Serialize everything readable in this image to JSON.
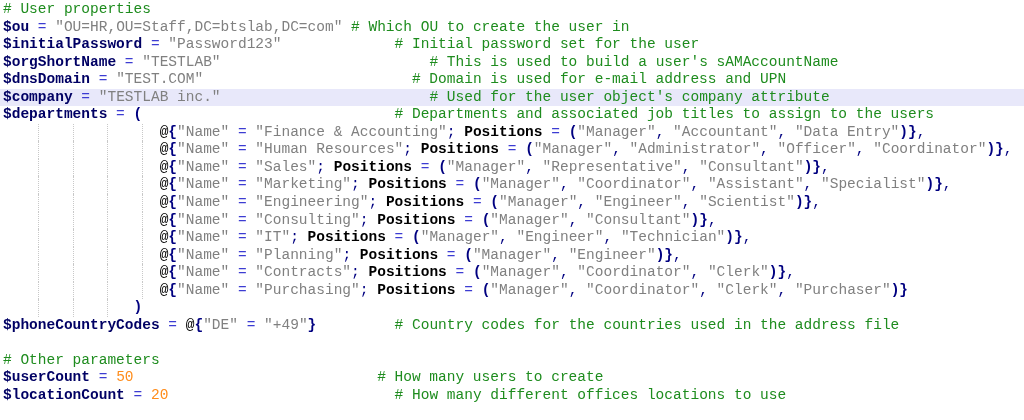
{
  "editor": {
    "lines": [
      {
        "kind": "code",
        "current": false,
        "comment": "# User properties"
      },
      {
        "kind": "code",
        "current": false,
        "code": [
          {
            "kind": "variable",
            "text": "$ou"
          },
          {
            "kind": "operator",
            "text": " = "
          },
          {
            "kind": "string",
            "text": "\"OU=HR,OU=Staff,DC=btslab,DC=com\""
          }
        ],
        "comment": "# Which OU to create the user in"
      },
      {
        "kind": "code",
        "current": false,
        "code": [
          {
            "kind": "variable",
            "text": "$initialPassword"
          },
          {
            "kind": "operator",
            "text": " = "
          },
          {
            "kind": "string",
            "text": "\"Password123\""
          }
        ],
        "comment": "# Initial password set for the user"
      },
      {
        "kind": "code",
        "current": false,
        "code": [
          {
            "kind": "variable",
            "text": "$orgShortName"
          },
          {
            "kind": "operator",
            "text": " = "
          },
          {
            "kind": "string",
            "text": "\"TESTLAB\""
          }
        ],
        "comment": "# This is used to build a user's sAMAccountName"
      },
      {
        "kind": "code",
        "current": false,
        "code": [
          {
            "kind": "variable",
            "text": "$dnsDomain"
          },
          {
            "kind": "operator",
            "text": " = "
          },
          {
            "kind": "string",
            "text": "\"TEST.COM\""
          }
        ],
        "comment": "# Domain is used for e-mail address and UPN"
      },
      {
        "kind": "code",
        "current": true,
        "code": [
          {
            "kind": "variable",
            "text": "$company"
          },
          {
            "kind": "operator",
            "text": " = "
          },
          {
            "kind": "string",
            "text": "\"TESTLAB inc.\""
          }
        ],
        "comment": "# Used for the user object's company attribute"
      },
      {
        "kind": "code",
        "current": false,
        "code": [
          {
            "kind": "variable",
            "text": "$departments"
          },
          {
            "kind": "operator",
            "text": " = "
          },
          {
            "kind": "bracket",
            "text": "("
          }
        ],
        "comment": "# Departments and associated job titles to assign to the users"
      },
      {
        "kind": "entry",
        "current": false,
        "code": [
          {
            "kind": "at",
            "text": "@"
          },
          {
            "kind": "bracket",
            "text": "{"
          },
          {
            "kind": "string",
            "text": "\"Name\""
          },
          {
            "kind": "operator",
            "text": " = "
          },
          {
            "kind": "string",
            "text": "\"Finance & Accounting\""
          },
          {
            "kind": "punct",
            "text": "; "
          },
          {
            "kind": "keyword",
            "text": "Positions"
          },
          {
            "kind": "operator",
            "text": " = "
          },
          {
            "kind": "bracket",
            "text": "("
          },
          {
            "kind": "string",
            "text": "\"Manager\""
          },
          {
            "kind": "punct",
            "text": ", "
          },
          {
            "kind": "string",
            "text": "\"Accountant\""
          },
          {
            "kind": "punct",
            "text": ", "
          },
          {
            "kind": "string",
            "text": "\"Data Entry\""
          },
          {
            "kind": "bracket",
            "text": ")}"
          },
          {
            "kind": "punct",
            "text": ","
          }
        ]
      },
      {
        "kind": "entry",
        "current": false,
        "code": [
          {
            "kind": "at",
            "text": "@"
          },
          {
            "kind": "bracket",
            "text": "{"
          },
          {
            "kind": "string",
            "text": "\"Name\""
          },
          {
            "kind": "operator",
            "text": " = "
          },
          {
            "kind": "string",
            "text": "\"Human Resources\""
          },
          {
            "kind": "punct",
            "text": "; "
          },
          {
            "kind": "keyword",
            "text": "Positions"
          },
          {
            "kind": "operator",
            "text": " = "
          },
          {
            "kind": "bracket",
            "text": "("
          },
          {
            "kind": "string",
            "text": "\"Manager\""
          },
          {
            "kind": "punct",
            "text": ", "
          },
          {
            "kind": "string",
            "text": "\"Administrator\""
          },
          {
            "kind": "punct",
            "text": ", "
          },
          {
            "kind": "string",
            "text": "\"Officer\""
          },
          {
            "kind": "punct",
            "text": ", "
          },
          {
            "kind": "string",
            "text": "\"Coordinator\""
          },
          {
            "kind": "bracket",
            "text": ")}"
          },
          {
            "kind": "punct",
            "text": ","
          }
        ]
      },
      {
        "kind": "entry",
        "current": false,
        "code": [
          {
            "kind": "at",
            "text": "@"
          },
          {
            "kind": "bracket",
            "text": "{"
          },
          {
            "kind": "string",
            "text": "\"Name\""
          },
          {
            "kind": "operator",
            "text": " = "
          },
          {
            "kind": "string",
            "text": "\"Sales\""
          },
          {
            "kind": "punct",
            "text": "; "
          },
          {
            "kind": "keyword",
            "text": "Positions"
          },
          {
            "kind": "operator",
            "text": " = "
          },
          {
            "kind": "bracket",
            "text": "("
          },
          {
            "kind": "string",
            "text": "\"Manager\""
          },
          {
            "kind": "punct",
            "text": ", "
          },
          {
            "kind": "string",
            "text": "\"Representative\""
          },
          {
            "kind": "punct",
            "text": ", "
          },
          {
            "kind": "string",
            "text": "\"Consultant\""
          },
          {
            "kind": "bracket",
            "text": ")}"
          },
          {
            "kind": "punct",
            "text": ","
          }
        ]
      },
      {
        "kind": "entry",
        "current": false,
        "code": [
          {
            "kind": "at",
            "text": "@"
          },
          {
            "kind": "bracket",
            "text": "{"
          },
          {
            "kind": "string",
            "text": "\"Name\""
          },
          {
            "kind": "operator",
            "text": " = "
          },
          {
            "kind": "string",
            "text": "\"Marketing\""
          },
          {
            "kind": "punct",
            "text": "; "
          },
          {
            "kind": "keyword",
            "text": "Positions"
          },
          {
            "kind": "operator",
            "text": " = "
          },
          {
            "kind": "bracket",
            "text": "("
          },
          {
            "kind": "string",
            "text": "\"Manager\""
          },
          {
            "kind": "punct",
            "text": ", "
          },
          {
            "kind": "string",
            "text": "\"Coordinator\""
          },
          {
            "kind": "punct",
            "text": ", "
          },
          {
            "kind": "string",
            "text": "\"Assistant\""
          },
          {
            "kind": "punct",
            "text": ", "
          },
          {
            "kind": "string",
            "text": "\"Specialist\""
          },
          {
            "kind": "bracket",
            "text": ")}"
          },
          {
            "kind": "punct",
            "text": ","
          }
        ]
      },
      {
        "kind": "entry",
        "current": false,
        "code": [
          {
            "kind": "at",
            "text": "@"
          },
          {
            "kind": "bracket",
            "text": "{"
          },
          {
            "kind": "string",
            "text": "\"Name\""
          },
          {
            "kind": "operator",
            "text": " = "
          },
          {
            "kind": "string",
            "text": "\"Engineering\""
          },
          {
            "kind": "punct",
            "text": "; "
          },
          {
            "kind": "keyword",
            "text": "Positions"
          },
          {
            "kind": "operator",
            "text": " = "
          },
          {
            "kind": "bracket",
            "text": "("
          },
          {
            "kind": "string",
            "text": "\"Manager\""
          },
          {
            "kind": "punct",
            "text": ", "
          },
          {
            "kind": "string",
            "text": "\"Engineer\""
          },
          {
            "kind": "punct",
            "text": ", "
          },
          {
            "kind": "string",
            "text": "\"Scientist\""
          },
          {
            "kind": "bracket",
            "text": ")}"
          },
          {
            "kind": "punct",
            "text": ","
          }
        ]
      },
      {
        "kind": "entry",
        "current": false,
        "code": [
          {
            "kind": "at",
            "text": "@"
          },
          {
            "kind": "bracket",
            "text": "{"
          },
          {
            "kind": "string",
            "text": "\"Name\""
          },
          {
            "kind": "operator",
            "text": " = "
          },
          {
            "kind": "string",
            "text": "\"Consulting\""
          },
          {
            "kind": "punct",
            "text": "; "
          },
          {
            "kind": "keyword",
            "text": "Positions"
          },
          {
            "kind": "operator",
            "text": " = "
          },
          {
            "kind": "bracket",
            "text": "("
          },
          {
            "kind": "string",
            "text": "\"Manager\""
          },
          {
            "kind": "punct",
            "text": ", "
          },
          {
            "kind": "string",
            "text": "\"Consultant\""
          },
          {
            "kind": "bracket",
            "text": ")}"
          },
          {
            "kind": "punct",
            "text": ","
          }
        ]
      },
      {
        "kind": "entry",
        "current": false,
        "code": [
          {
            "kind": "at",
            "text": "@"
          },
          {
            "kind": "bracket",
            "text": "{"
          },
          {
            "kind": "string",
            "text": "\"Name\""
          },
          {
            "kind": "operator",
            "text": " = "
          },
          {
            "kind": "string",
            "text": "\"IT\""
          },
          {
            "kind": "punct",
            "text": "; "
          },
          {
            "kind": "keyword",
            "text": "Positions"
          },
          {
            "kind": "operator",
            "text": " = "
          },
          {
            "kind": "bracket",
            "text": "("
          },
          {
            "kind": "string",
            "text": "\"Manager\""
          },
          {
            "kind": "punct",
            "text": ", "
          },
          {
            "kind": "string",
            "text": "\"Engineer\""
          },
          {
            "kind": "punct",
            "text": ", "
          },
          {
            "kind": "string",
            "text": "\"Technician\""
          },
          {
            "kind": "bracket",
            "text": ")}"
          },
          {
            "kind": "punct",
            "text": ","
          }
        ]
      },
      {
        "kind": "entry",
        "current": false,
        "code": [
          {
            "kind": "at",
            "text": "@"
          },
          {
            "kind": "bracket",
            "text": "{"
          },
          {
            "kind": "string",
            "text": "\"Name\""
          },
          {
            "kind": "operator",
            "text": " = "
          },
          {
            "kind": "string",
            "text": "\"Planning\""
          },
          {
            "kind": "punct",
            "text": "; "
          },
          {
            "kind": "keyword",
            "text": "Positions"
          },
          {
            "kind": "operator",
            "text": " = "
          },
          {
            "kind": "bracket",
            "text": "("
          },
          {
            "kind": "string",
            "text": "\"Manager\""
          },
          {
            "kind": "punct",
            "text": ", "
          },
          {
            "kind": "string",
            "text": "\"Engineer\""
          },
          {
            "kind": "bracket",
            "text": ")}"
          },
          {
            "kind": "punct",
            "text": ","
          }
        ]
      },
      {
        "kind": "entry",
        "current": false,
        "code": [
          {
            "kind": "at",
            "text": "@"
          },
          {
            "kind": "bracket",
            "text": "{"
          },
          {
            "kind": "string",
            "text": "\"Name\""
          },
          {
            "kind": "operator",
            "text": " = "
          },
          {
            "kind": "string",
            "text": "\"Contracts\""
          },
          {
            "kind": "punct",
            "text": "; "
          },
          {
            "kind": "keyword",
            "text": "Positions"
          },
          {
            "kind": "operator",
            "text": " = "
          },
          {
            "kind": "bracket",
            "text": "("
          },
          {
            "kind": "string",
            "text": "\"Manager\""
          },
          {
            "kind": "punct",
            "text": ", "
          },
          {
            "kind": "string",
            "text": "\"Coordinator\""
          },
          {
            "kind": "punct",
            "text": ", "
          },
          {
            "kind": "string",
            "text": "\"Clerk\""
          },
          {
            "kind": "bracket",
            "text": ")}"
          },
          {
            "kind": "punct",
            "text": ","
          }
        ]
      },
      {
        "kind": "entry",
        "current": false,
        "code": [
          {
            "kind": "at",
            "text": "@"
          },
          {
            "kind": "bracket",
            "text": "{"
          },
          {
            "kind": "string",
            "text": "\"Name\""
          },
          {
            "kind": "operator",
            "text": " = "
          },
          {
            "kind": "string",
            "text": "\"Purchasing\""
          },
          {
            "kind": "punct",
            "text": "; "
          },
          {
            "kind": "keyword",
            "text": "Positions"
          },
          {
            "kind": "operator",
            "text": " = "
          },
          {
            "kind": "bracket",
            "text": "("
          },
          {
            "kind": "string",
            "text": "\"Manager\""
          },
          {
            "kind": "punct",
            "text": ", "
          },
          {
            "kind": "string",
            "text": "\"Coordinator\""
          },
          {
            "kind": "punct",
            "text": ", "
          },
          {
            "kind": "string",
            "text": "\"Clerk\""
          },
          {
            "kind": "punct",
            "text": ", "
          },
          {
            "kind": "string",
            "text": "\"Purchaser\""
          },
          {
            "kind": "bracket",
            "text": ")}"
          }
        ]
      },
      {
        "kind": "close",
        "current": false,
        "code": [
          {
            "kind": "bracket",
            "text": ")"
          }
        ]
      },
      {
        "kind": "code",
        "current": false,
        "code": [
          {
            "kind": "variable",
            "text": "$phoneCountryCodes"
          },
          {
            "kind": "operator",
            "text": " = "
          },
          {
            "kind": "at",
            "text": "@"
          },
          {
            "kind": "bracket",
            "text": "{"
          },
          {
            "kind": "string",
            "text": "\"DE\""
          },
          {
            "kind": "operator",
            "text": " = "
          },
          {
            "kind": "string",
            "text": "\"+49\""
          },
          {
            "kind": "bracket",
            "text": "}"
          }
        ],
        "comment": "# Country codes for the countries used in the address file"
      },
      {
        "kind": "blank",
        "current": false
      },
      {
        "kind": "code",
        "current": false,
        "comment": "# Other parameters"
      },
      {
        "kind": "code",
        "current": false,
        "code": [
          {
            "kind": "variable",
            "text": "$userCount"
          },
          {
            "kind": "operator",
            "text": " = "
          },
          {
            "kind": "number",
            "text": "50"
          }
        ],
        "comment": "# How many users to create"
      },
      {
        "kind": "code",
        "current": false,
        "code": [
          {
            "kind": "variable",
            "text": "$locationCount"
          },
          {
            "kind": "operator",
            "text": " = "
          },
          {
            "kind": "number",
            "text": "20"
          }
        ],
        "comment": "# How many different offices locations to use"
      }
    ]
  }
}
